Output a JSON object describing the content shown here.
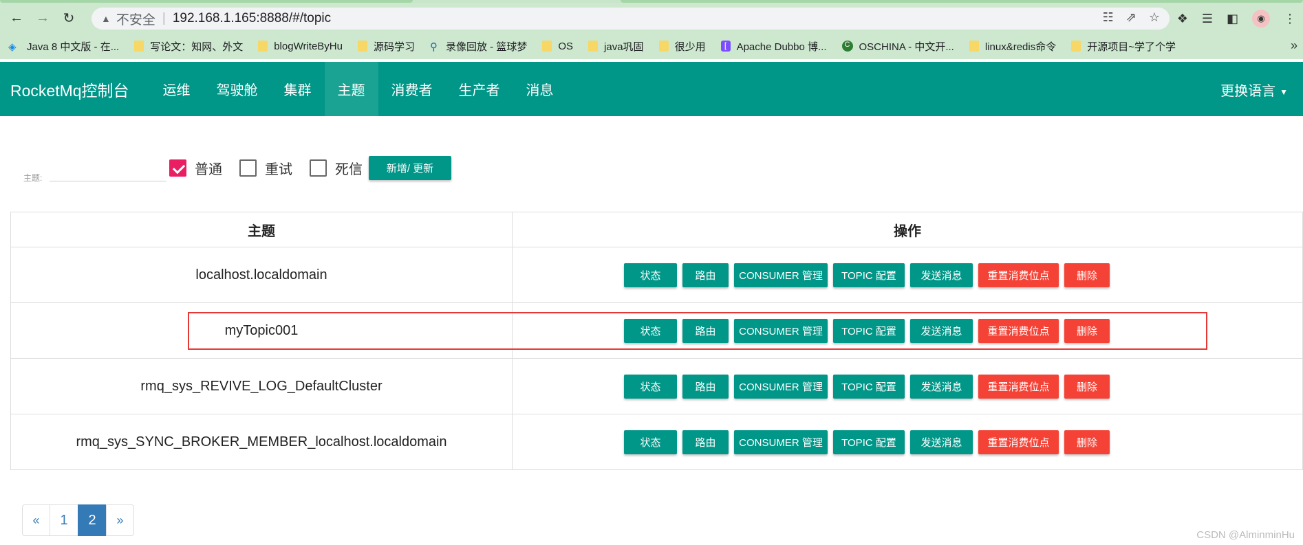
{
  "browser": {
    "security_label": "不安全",
    "url": "192.168.1.165:8888/#/topic",
    "bookmarks": [
      {
        "label": "Java 8 中文版 - 在...",
        "icon": "globe-icon"
      },
      {
        "label": "写论文：知网、外文",
        "icon": "folder-icon"
      },
      {
        "label": "blogWriteByHu",
        "icon": "folder-icon"
      },
      {
        "label": "源码学习",
        "icon": "folder-icon"
      },
      {
        "label": "录像回放 - 篮球梦",
        "icon": "runner-icon"
      },
      {
        "label": "OS",
        "icon": "folder-icon"
      },
      {
        "label": "java巩固",
        "icon": "folder-icon"
      },
      {
        "label": "很少用",
        "icon": "folder-icon"
      },
      {
        "label": "Apache Dubbo 博...",
        "icon": "dubbo-icon"
      },
      {
        "label": "OSCHINA - 中文开...",
        "icon": "oschina-icon"
      },
      {
        "label": "linux&redis命令",
        "icon": "folder-icon"
      },
      {
        "label": "开源项目~学了个学",
        "icon": "folder-icon"
      }
    ]
  },
  "app": {
    "brand": "RocketMq控制台",
    "nav": [
      "运维",
      "驾驶舱",
      "集群",
      "主题",
      "消费者",
      "生产者",
      "消息"
    ],
    "active_nav": "主题",
    "language": "更换语言"
  },
  "filter": {
    "topic_label": "主题:",
    "topic_value": "",
    "checkboxes": [
      {
        "label": "普通",
        "checked": true
      },
      {
        "label": "重试",
        "checked": false
      },
      {
        "label": "死信",
        "checked": false
      }
    ],
    "add_button": "新增/ 更新"
  },
  "table": {
    "headers": [
      "主题",
      "操作"
    ],
    "rows": [
      {
        "topic": "localhost.localdomain"
      },
      {
        "topic": "myTopic001"
      },
      {
        "topic": "rmq_sys_REVIVE_LOG_DefaultCluster"
      },
      {
        "topic": "rmq_sys_SYNC_BROKER_MEMBER_localhost.localdomain"
      }
    ],
    "actions": [
      "状态",
      "路由",
      "CONSUMER 管理",
      "TOPIC 配置",
      "发送消息",
      "重置消费位点",
      "删除"
    ],
    "highlighted_row": "myTopic001"
  },
  "pagination": {
    "prev": "«",
    "pages": [
      "1",
      "2"
    ],
    "current": "2",
    "next": "»"
  },
  "watermark": "CSDN @AlminminHu",
  "colors": {
    "primary": "#009688",
    "danger": "#f44336",
    "checkbox": "#e91e63",
    "page_active": "#337ab7"
  }
}
